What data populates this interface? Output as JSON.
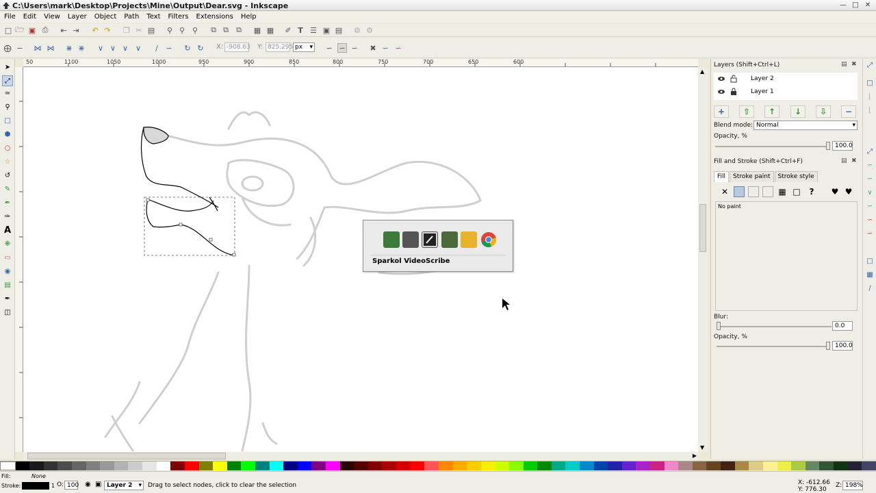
{
  "window": {
    "title": "C:\\Users\\mark\\Desktop\\Projects\\Mine\\Output\\Dear.svg - Inkscape"
  },
  "menu": [
    "File",
    "Edit",
    "View",
    "Layer",
    "Object",
    "Path",
    "Text",
    "Filters",
    "Extensions",
    "Help"
  ],
  "node_toolbar": {
    "x_label": "X:",
    "x_value": "-908.63",
    "y_label": "Y:",
    "y_value": "825.295",
    "units": "px"
  },
  "rulers": {
    "h_labels": [
      "50",
      "1100",
      "1050",
      "1000",
      "950",
      "900",
      "850",
      "800",
      "750",
      "700",
      "650",
      "600"
    ]
  },
  "layers_panel": {
    "title": "Layers (Shift+Ctrl+L)",
    "layers": [
      {
        "name": "Layer 2"
      },
      {
        "name": "Layer 1"
      }
    ],
    "blend_label": "Blend mode:",
    "blend_value": "Normal",
    "opacity_label": "Opacity, %",
    "opacity_value": "100.0"
  },
  "fill_stroke_panel": {
    "title": "Fill and Stroke (Shift+Ctrl+F)",
    "tabs": [
      "Fill",
      "Stroke paint",
      "Stroke style"
    ],
    "no_paint": "No paint",
    "blur_label": "Blur:",
    "blur_value": "0.0",
    "opacity_label": "Opacity, %",
    "opacity_value": "100.0"
  },
  "taskbar_popup": {
    "label": "Sparkol VideoScribe"
  },
  "status": {
    "fill_label": "Fill:",
    "stroke_label": "Stroke:",
    "fill_value": "None",
    "stroke_width": "1",
    "opacity_label": "O:",
    "opacity_value": "100",
    "layer_name": "Layer 2",
    "message": "Drag to select nodes, click to clear the selection",
    "cursor_x": "X: -612.66",
    "cursor_y": "Y: 776.30",
    "zoom_label": "Z:",
    "zoom_value": "198%"
  },
  "colors": {
    "accent": "#7f9db9",
    "selection": "#c7d6ef",
    "sketch": "#c8c8c8"
  }
}
